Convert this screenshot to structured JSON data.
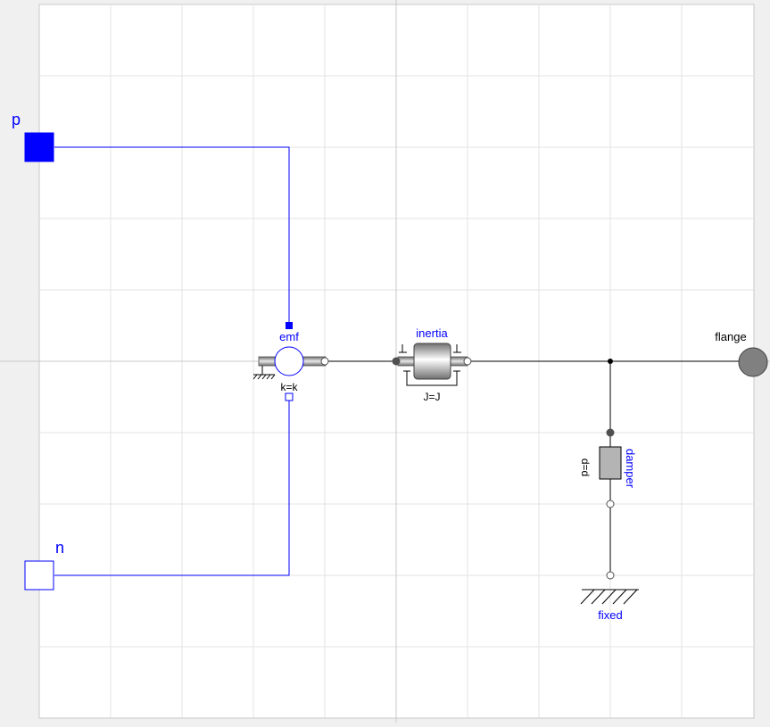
{
  "ports": {
    "p_label": "p",
    "n_label": "n",
    "flange_label": "flange"
  },
  "components": {
    "emf": {
      "name": "emf",
      "param": "k=k"
    },
    "inertia": {
      "name": "inertia",
      "param": "J=J"
    },
    "damper": {
      "name": "damper",
      "param": "d=d"
    },
    "fixed": {
      "name": "fixed"
    }
  },
  "colors": {
    "electrical": "#0000ff",
    "label_blue": "#0000ff",
    "mechanical": "#000000",
    "grid": "#e0e0e0",
    "axis": "#c8c8c8",
    "flange_fill": "#808080"
  }
}
